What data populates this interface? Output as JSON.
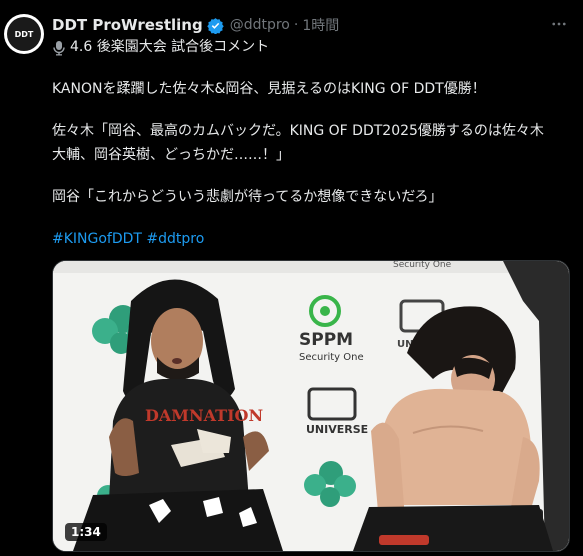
{
  "account": {
    "name": "DDT ProWrestling",
    "handle": "@ddtpro",
    "separator": "·",
    "time": "1時間",
    "avatar_text": "DDT"
  },
  "tweet": {
    "line1": "4.6 後楽園大会 試合後コメント",
    "line2": "KANONを蹂躙した佐々木&岡谷、見据えるのはKING OF DDT優勝！",
    "line3": "佐々木「岡谷、最高のカムバックだ。KING OF DDT2025優勝するのは佐々木",
    "line4": "大輔、岡谷英樹、どっちかだ……！」",
    "line5": "岡谷「これからどういう悲劇が待ってるか想像できないだろ」",
    "hashtag1": "#KINGofDDT",
    "hashtag2": "#ddtpro"
  },
  "media": {
    "duration": "1:34",
    "sponsor_text_1": "SPPM",
    "sponsor_text_2": "Security One",
    "sponsor_text_3": "UNIVERSE",
    "shirt_text": "DAMNATION"
  },
  "icons": {
    "verified": "verified-badge-icon",
    "more": "more-options-icon",
    "mic": "microphone-icon"
  },
  "colors": {
    "background": "#000000",
    "text": "#e7e9ea",
    "muted": "#71767b",
    "link": "#1d9bf0"
  }
}
